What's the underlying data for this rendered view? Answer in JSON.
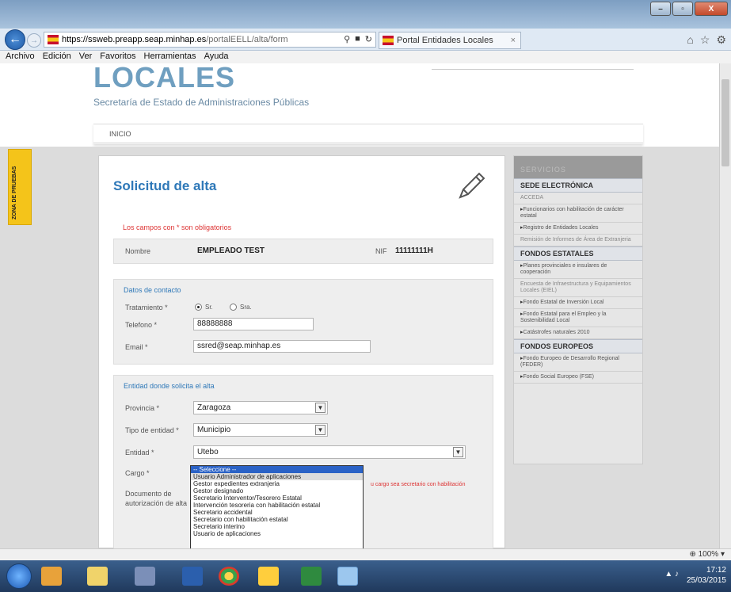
{
  "browser": {
    "url_host": "https://ssweb.preapp.seap.minhap.es",
    "url_path": "/portalEELL/alta/form",
    "tab_title": "Portal Entidades Locales",
    "window_buttons": [
      "–",
      "▫",
      "X"
    ]
  },
  "menubar": [
    "Archivo",
    "Edición",
    "Ver",
    "Favoritos",
    "Herramientas",
    "Ayuda"
  ],
  "header": {
    "logo_word": "LOCALES",
    "subtitle": "Secretaría de Estado de Administraciones Públicas",
    "nav_inicio": "INICIO"
  },
  "zona_tab": "ZONA DE PRUEBAS",
  "form": {
    "title": "Solicitud de alta",
    "required_note": "Los campos con * son obligatorios",
    "nombre_label": "Nombre",
    "nombre_value": "EMPLEADO TEST",
    "nif_label": "NIF",
    "nif_value": "11111111H",
    "contacto": {
      "title": "Datos de contacto",
      "tratamiento_label": "Tratamiento *",
      "radio_sr": "Sr.",
      "radio_sra": "Sra.",
      "telefono_label": "Telefono *",
      "telefono_value": "88888888",
      "email_label": "Email *",
      "email_value": "ssred@seap.minhap.es"
    },
    "entidad": {
      "title": "Entidad donde solicita el alta",
      "provincia_label": "Provincia *",
      "provincia_value": "Zaragoza",
      "tipo_label": "Tipo de entidad *",
      "tipo_value": "Municipio",
      "entidad_label": "Entidad *",
      "entidad_value": "Utebo",
      "cargo_label": "Cargo *",
      "doc_label_1": "Documento de",
      "doc_label_2": "autorización de alta",
      "hint": "u cargo sea secretario con habilitación"
    },
    "cargo_options": [
      "-- Seleccione --",
      "Usuario Administrador de aplicaciones",
      "Gestor expedientes extranjeria",
      "Gestor designado",
      "Secretario Interventor/Tesorero Estatal",
      "Intervención tesoreria con habilitación estatal",
      "Secretario accidental",
      "Secretario con habilitación estatal",
      "Secretario interino",
      "Usuario de aplicaciones"
    ]
  },
  "sidebar": {
    "head": "SERVICIOS",
    "sections": [
      {
        "title": "SEDE ELECTRÓNICA",
        "items": [
          {
            "label": "ACCEDA",
            "bullet": false
          },
          {
            "label": "Funcionarios con habilitación de carácter estatal",
            "bullet": true
          },
          {
            "label": "Registro de Entidades Locales",
            "bullet": true
          },
          {
            "label": "Remisión de Informes de Área de Extranjeria",
            "bullet": false
          }
        ]
      },
      {
        "title": "FONDOS ESTATALES",
        "items": [
          {
            "label": "Planes provinciales e insulares de cooperación",
            "bullet": true
          },
          {
            "label": "Encuesta de Infraestructura y Equipamientos Locales (EIEL)",
            "bullet": false
          },
          {
            "label": "Fondo Estatal de Inversión Local",
            "bullet": true
          },
          {
            "label": "Fondo Estatal para el Empleo y la Sostenibilidad Local",
            "bullet": true
          },
          {
            "label": "Catástrofes naturales 2010",
            "bullet": true
          }
        ]
      },
      {
        "title": "FONDOS EUROPEOS",
        "items": [
          {
            "label": "Fondo Europeo de Desarrollo Regional (FEDER)",
            "bullet": true
          },
          {
            "label": "Fondo Social Europeo (FSE)",
            "bullet": true
          }
        ]
      }
    ]
  },
  "status": {
    "zoom": "100%"
  },
  "taskbar": {
    "time": "17:12",
    "date": "25/03/2015"
  }
}
